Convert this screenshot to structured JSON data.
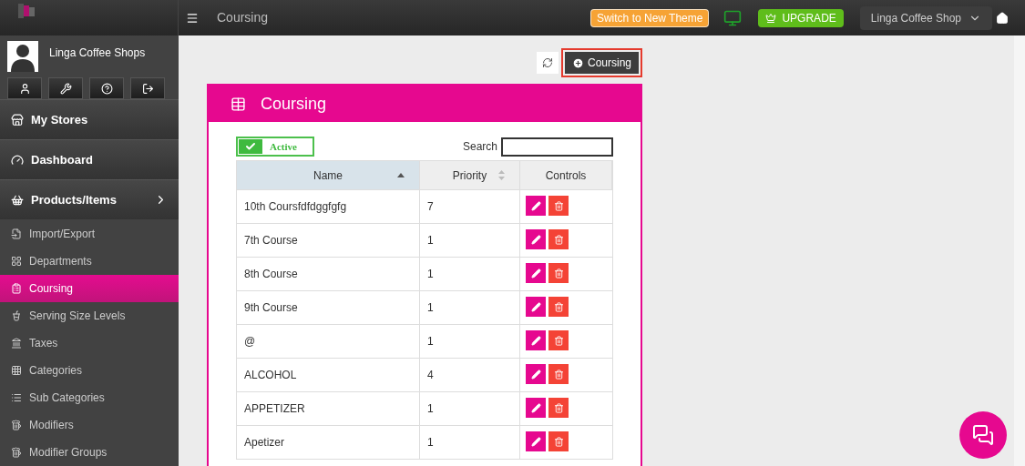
{
  "header": {
    "page_title": "Coursing",
    "theme_button": "Switch to New Theme",
    "upgrade_button": "UPGRADE",
    "store_selector": "Linga Coffee Shop"
  },
  "profile": {
    "name": "Linga Coffee Shops"
  },
  "sidebar": {
    "main_items": [
      {
        "label": "My Stores",
        "expandable": false
      },
      {
        "label": "Dashboard",
        "expandable": false
      },
      {
        "label": "Products/Items",
        "expandable": true
      }
    ],
    "items": [
      {
        "label": "Import/Export",
        "selected": false
      },
      {
        "label": "Departments",
        "selected": false
      },
      {
        "label": "Coursing",
        "selected": true
      },
      {
        "label": "Serving Size Levels",
        "selected": false
      },
      {
        "label": "Taxes",
        "selected": false
      },
      {
        "label": "Categories",
        "selected": false
      },
      {
        "label": "Sub Categories",
        "selected": false
      },
      {
        "label": "Modifiers",
        "selected": false
      },
      {
        "label": "Modifier Groups",
        "selected": false
      }
    ]
  },
  "add_button": "Coursing",
  "card": {
    "title": "Coursing",
    "active_toggle": {
      "label": "Active",
      "checked": true
    },
    "search": {
      "label": "Search"
    },
    "table": {
      "columns": [
        {
          "label": "Name",
          "sortable": true,
          "sorted": true
        },
        {
          "label": "Priority",
          "sortable": true,
          "sorted": false
        },
        {
          "label": "Controls",
          "sortable": false,
          "sorted": false
        }
      ],
      "rows": [
        {
          "name": "10th Coursfdfdggfgfg",
          "priority": "7"
        },
        {
          "name": "7th Course",
          "priority": "1"
        },
        {
          "name": "8th Course",
          "priority": "1"
        },
        {
          "name": "9th Course",
          "priority": "1"
        },
        {
          "name": "@",
          "priority": "1"
        },
        {
          "name": "ALCOHOL",
          "priority": "4"
        },
        {
          "name": "APPETIZER",
          "priority": "1"
        },
        {
          "name": "Apetizer",
          "priority": "1"
        }
      ]
    }
  }
}
